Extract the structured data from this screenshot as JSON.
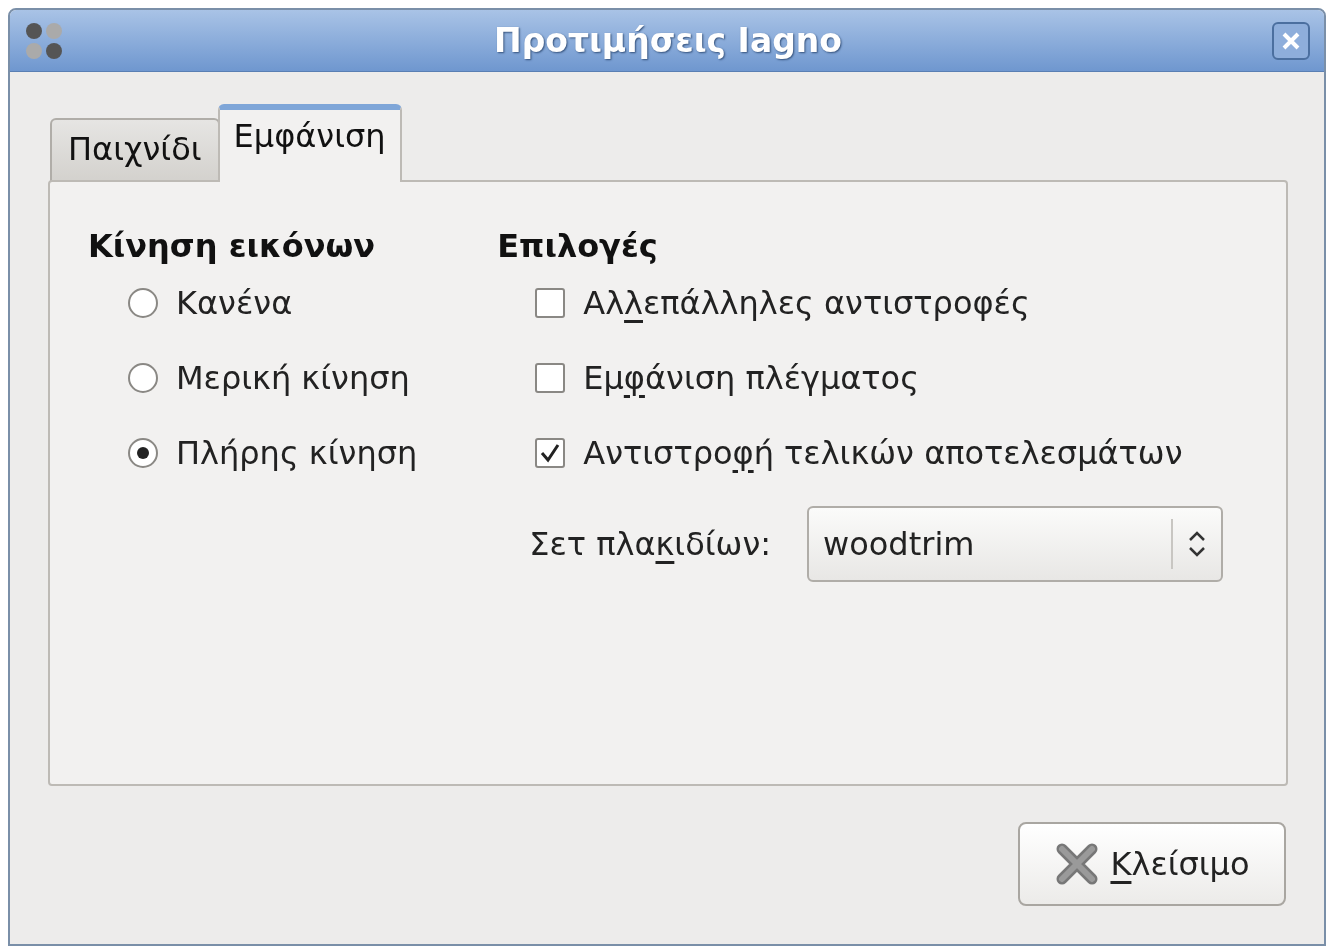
{
  "window": {
    "title": "Προτιμήσεις Iagno"
  },
  "tabs": [
    {
      "label": "Παιχνίδι",
      "selected": false
    },
    {
      "label": "Εμφάνιση",
      "selected": true
    }
  ],
  "animation": {
    "heading": "Κίνηση εικόνων",
    "options": [
      {
        "label": "Κανένα",
        "selected": false
      },
      {
        "label": "Μερική κίνηση",
        "selected": false
      },
      {
        "label": "Πλήρης κίνηση",
        "selected": true
      }
    ]
  },
  "options": {
    "heading": "Επιλογές",
    "checkboxes": [
      {
        "label": {
          "before": "Αλ",
          "key": "λ",
          "after": "επάλληλες αντιστροφές"
        },
        "checked": false
      },
      {
        "label": {
          "before": "Εμ",
          "key": "φ",
          "after": "άνιση πλέγματος"
        },
        "checked": false
      },
      {
        "label": {
          "before": "Αντιστρο",
          "key": "φ",
          "after": "ή τελικών αποτελεσμάτων"
        },
        "checked": true
      }
    ],
    "tile_set": {
      "label": {
        "before": "Σετ πλα",
        "key": "κ",
        "after": "ιδίων:"
      },
      "value": "woodtrim"
    }
  },
  "buttons": [
    {
      "label": {
        "key": "Κ",
        "after": "λείσιμο"
      }
    }
  ]
}
